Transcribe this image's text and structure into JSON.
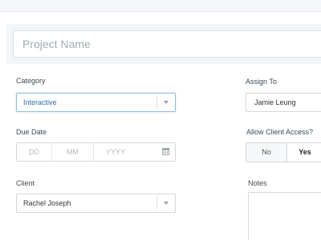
{
  "form": {
    "project_name_placeholder": "Project Name",
    "category": {
      "label": "Category",
      "value": "Interactive"
    },
    "assign_to": {
      "label": "Assign To",
      "value": "Jamie Leung"
    },
    "due_date": {
      "label": "Due Date",
      "day_placeholder": "DD",
      "month_placeholder": "MM",
      "year_placeholder": "YYYY"
    },
    "allow_client_access": {
      "label": "Allow Client Access?",
      "options": [
        "No",
        "Yes"
      ],
      "selected": "Yes"
    },
    "client": {
      "label": "Client",
      "value": "Rachel Joseph"
    },
    "notes": {
      "label": "Notes",
      "value": ""
    }
  },
  "icons": {
    "category_dropdown": "chevron-down-icon",
    "client_dropdown": "chevron-down-icon",
    "due_date_picker": "calendar-icon"
  },
  "colors": {
    "focused_border": "#8fbfe3",
    "focused_text": "#2b6eac",
    "placeholder": "#a4abb3"
  }
}
